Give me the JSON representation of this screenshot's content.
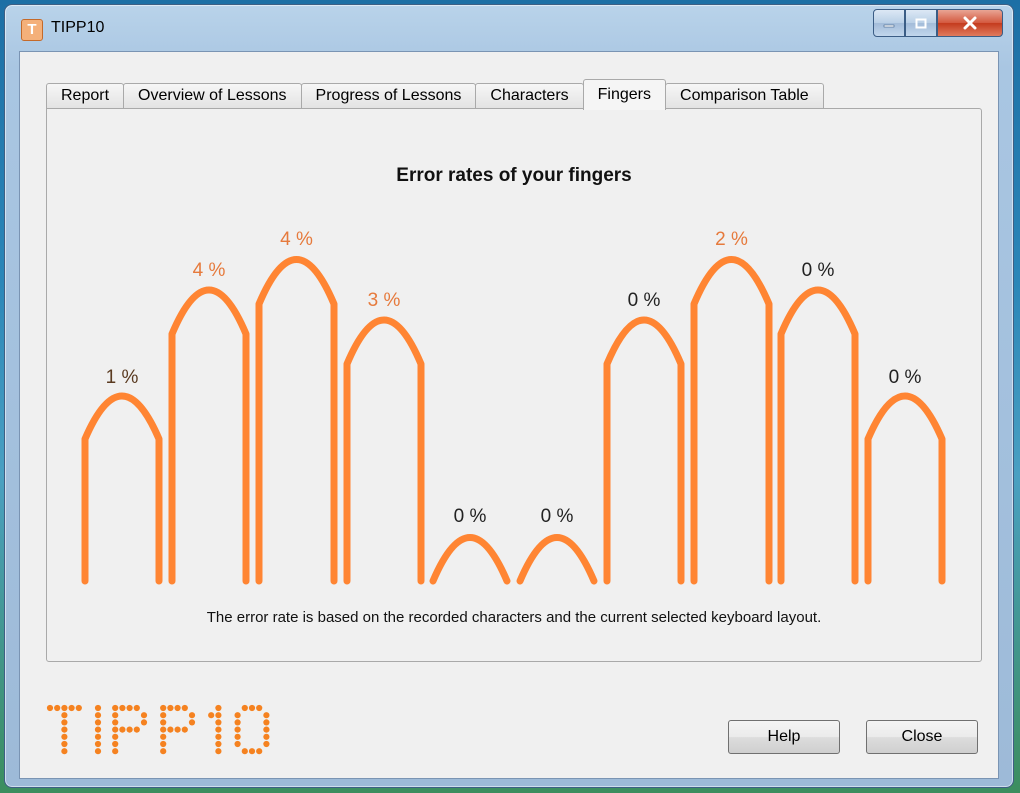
{
  "window": {
    "title": "TIPP10",
    "app_icon_glyph": "T",
    "controls": {
      "minimize": "minimize-icon",
      "maximize": "maximize-icon",
      "close": "close-icon"
    }
  },
  "tabs": [
    {
      "label": "Report",
      "active": false
    },
    {
      "label": "Overview of Lessons",
      "active": false
    },
    {
      "label": "Progress of Lessons",
      "active": false
    },
    {
      "label": "Characters",
      "active": false
    },
    {
      "label": "Fingers",
      "active": true
    },
    {
      "label": "Comparison Table",
      "active": false
    }
  ],
  "panel": {
    "footnote": "The error rate is based on the recorded characters and the current selected keyboard layout."
  },
  "chart_data": {
    "type": "bar",
    "title": "Error rates of your fingers",
    "categories": [
      "",
      "",
      "",
      "",
      "",
      "",
      "",
      "",
      "",
      ""
    ],
    "values": [
      1,
      4,
      4,
      3,
      0,
      0,
      0,
      2,
      0,
      0
    ],
    "labels": [
      "1 %",
      "4 %",
      "4 %",
      "3 %",
      "0 %",
      "0 %",
      "0 %",
      "2 %",
      "0 %",
      "0 %"
    ],
    "label_colors": [
      "#5a3a20",
      "#e67a3c",
      "#e67a3c",
      "#e67a3c",
      "#222222",
      "#222222",
      "#222222",
      "#e67a3c",
      "#222222",
      "#222222"
    ],
    "finger_heights": [
      "medium",
      "tall",
      "tallest",
      "tall-short",
      "thumb",
      "thumb",
      "tall-short",
      "tallest",
      "tall",
      "medium"
    ],
    "stroke_color": "#ff8533"
  },
  "logo": {
    "text": "TIPP10",
    "color": "#f58220"
  },
  "buttons": {
    "help": "Help",
    "close": "Close"
  }
}
